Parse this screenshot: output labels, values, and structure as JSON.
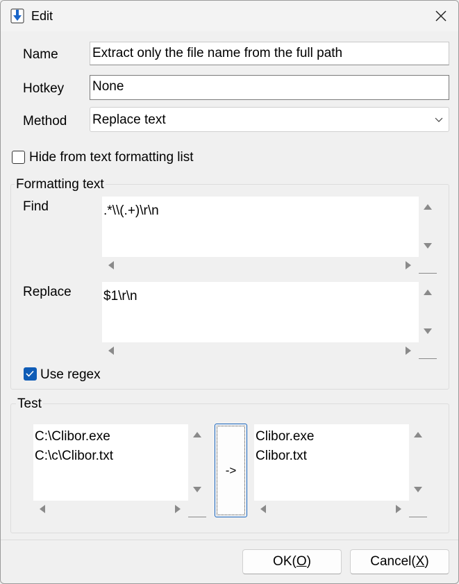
{
  "window": {
    "title": "Edit",
    "close_icon": "close-icon",
    "app_icon": "download-arrow-icon"
  },
  "form": {
    "name_label": "Name",
    "name_value": "Extract only the file name from the full path",
    "hotkey_label": "Hotkey",
    "hotkey_value": "None",
    "method_label": "Method",
    "method_value": "Replace text",
    "hide_label": "Hide from text formatting list",
    "hide_checked": false
  },
  "formatting": {
    "group_title": "Formatting text",
    "find_label": "Find",
    "find_value": ".*\\\\(.+)\\r\\n",
    "replace_label": "Replace",
    "replace_value": "$1\\r\\n",
    "regex_label": "Use regex",
    "regex_checked": true
  },
  "test": {
    "group_title": "Test",
    "input_text": "C:\\Clibor.exe\nC:\\c\\Clibor.txt",
    "run_label": "->",
    "output_text": "Clibor.exe\nClibor.txt"
  },
  "footer": {
    "ok_prefix": "OK(",
    "ok_key": "O",
    "ok_suffix": ")",
    "cancel_prefix": "Cancel(",
    "cancel_key": "X",
    "cancel_suffix": ")"
  },
  "colors": {
    "accent": "#0f5cb6",
    "background": "#f0f0f0",
    "field": "#ffffff"
  }
}
